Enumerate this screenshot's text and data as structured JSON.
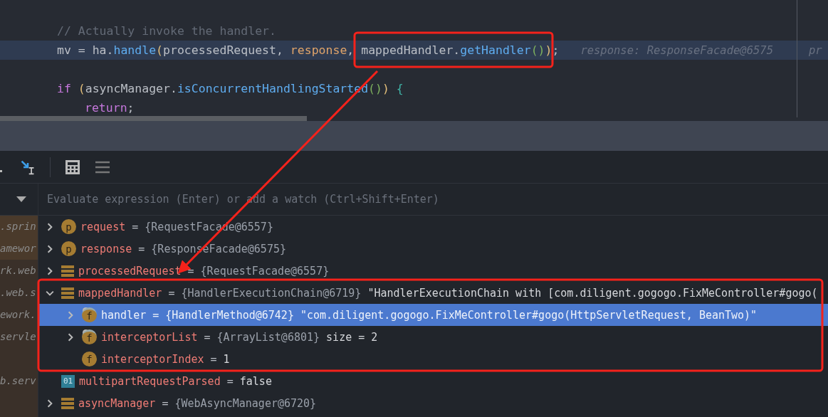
{
  "editor": {
    "lines": [
      {
        "current": false,
        "indented": false,
        "tokens": [
          {
            "text": "// Actually invoke the handler.",
            "kind": "comment"
          }
        ]
      },
      {
        "current": true,
        "indented": false,
        "tokens": [
          {
            "text": "mv = ha.",
            "kind": "plain"
          },
          {
            "text": "handle",
            "kind": "method"
          },
          {
            "text": "(",
            "kind": "paren1"
          },
          {
            "text": "processedRequest, ",
            "kind": "plain"
          },
          {
            "text": "response",
            "kind": "param"
          },
          {
            "text": ", mappedHandler.",
            "kind": "plain"
          },
          {
            "text": "getHandler",
            "kind": "method"
          },
          {
            "text": "()",
            "kind": "paren2"
          },
          {
            "text": ")",
            "kind": "paren1"
          },
          {
            "text": ";",
            "kind": "plain"
          }
        ],
        "hints": [
          "response: ResponseFacade@6575",
          "pr"
        ]
      },
      {
        "current": false
      },
      {
        "current": false,
        "indented": false,
        "tokens": [
          {
            "text": "if",
            "kind": "keyword"
          },
          {
            "text": " (",
            "kind": "paren1"
          },
          {
            "text": "asyncManager.",
            "kind": "plain"
          },
          {
            "text": "isConcurrentHandlingStarted",
            "kind": "method"
          },
          {
            "text": "()",
            "kind": "paren2"
          },
          {
            "text": ")",
            "kind": "paren1"
          },
          {
            "text": " {",
            "kind": "brace"
          }
        ]
      },
      {
        "current": false,
        "indented": true,
        "tokens": [
          {
            "text": "return",
            "kind": "keyword"
          },
          {
            "text": ";",
            "kind": "plain"
          }
        ]
      }
    ]
  },
  "frames": [
    {
      "text": ".sprin",
      "highlighted": true
    },
    {
      "text": "amewor",
      "highlighted": true
    },
    {
      "text": "rk.web",
      "highlighted": false
    },
    {
      "text": ".web.s",
      "highlighted": false
    },
    {
      "text": "ework.",
      "highlighted": false
    },
    {
      "text": "servle",
      "highlighted": false
    },
    {
      "highlighted": false
    },
    {
      "text": "b.serv",
      "highlighted": false
    }
  ],
  "watch": {
    "placeholder": "Evaluate expression (Enter) or add a watch (Ctrl+Shift+Enter)"
  },
  "variables": [
    {
      "name": "request",
      "op": "=",
      "ref": "{RequestFacade@6557}",
      "icon": {
        "kind": "parameter",
        "label": "p"
      },
      "expanded": false,
      "selected": false
    },
    {
      "name": "response",
      "op": "=",
      "ref": "{ResponseFacade@6575}",
      "icon": {
        "kind": "parameter",
        "label": "p"
      },
      "expanded": false,
      "selected": false
    },
    {
      "name": "processedRequest",
      "op": "=",
      "ref": "{RequestFacade@6557}",
      "icon": {
        "kind": "object"
      },
      "expanded": false,
      "selected": false
    },
    {
      "name": "mappedHandler",
      "op": "=",
      "ref": "{HandlerExecutionChain@6719}",
      "value": "\"HandlerExecutionChain with [com.diligent.gogogo.FixMeController#gogo(",
      "icon": {
        "kind": "object"
      },
      "expanded": true,
      "selected": false,
      "children": [
        {
          "name": "handler",
          "op": "=",
          "ref": "{HandlerMethod@6742}",
          "value": "\"com.diligent.gogogo.FixMeController#gogo(HttpServletRequest, BeanTwo)\"",
          "icon": {
            "kind": "field",
            "label": "f"
          },
          "expanded": false,
          "selected": true,
          "badge": true
        },
        {
          "name": "interceptorList",
          "op": "=",
          "ref": "{ArrayList@6801}",
          "value": " size = 2",
          "icon": {
            "kind": "field",
            "label": "f"
          },
          "expanded": false,
          "selected": false,
          "badge": true
        },
        {
          "name": "interceptorIndex",
          "op": "=",
          "value": "1",
          "icon": {
            "kind": "field",
            "label": "f"
          },
          "selected": false
        }
      ]
    },
    {
      "name": "multipartRequestParsed",
      "op": "=",
      "value": "false",
      "icon": {
        "kind": "boolean",
        "label": "01"
      },
      "selected": false
    },
    {
      "name": "asyncManager",
      "op": "=",
      "ref": "{WebAsyncManager@6720}",
      "icon": {
        "kind": "object"
      },
      "expanded": false,
      "selected": false
    }
  ]
}
